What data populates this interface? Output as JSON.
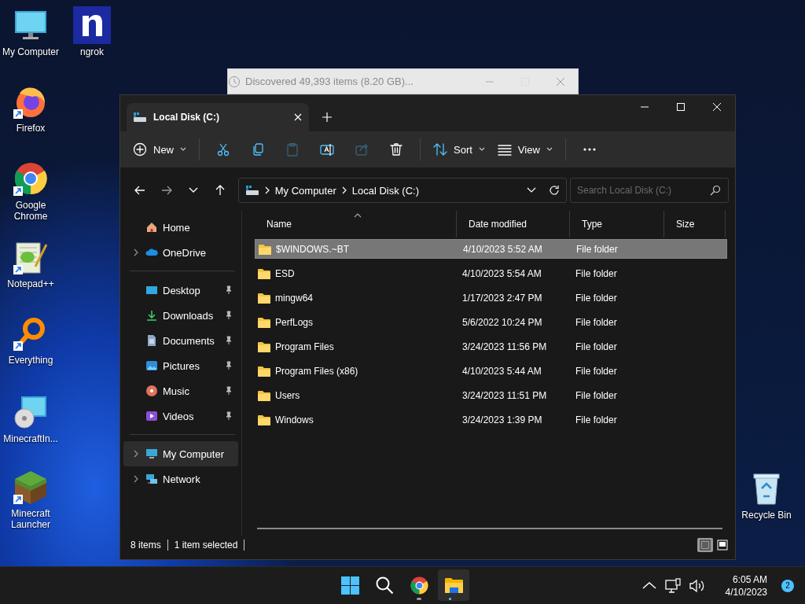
{
  "desktop_icons": [
    {
      "label": "My Computer",
      "kind": "computer",
      "shortcut": false
    },
    {
      "label": "ngrok",
      "kind": "ngrok",
      "shortcut": false
    },
    {
      "label": "Firefox",
      "kind": "firefox",
      "shortcut": true
    },
    {
      "label": "Google Chrome",
      "kind": "chrome",
      "shortcut": true
    },
    {
      "label": "Notepad++",
      "kind": "notepad",
      "shortcut": true
    },
    {
      "label": "Everything",
      "kind": "everything",
      "shortcut": true
    },
    {
      "label": "MinecraftIn...",
      "kind": "installer",
      "shortcut": false
    },
    {
      "label": "Minecraft Launcher",
      "kind": "minecraft",
      "shortcut": true
    },
    {
      "label": "Recycle Bin",
      "kind": "recycle",
      "shortcut": false
    }
  ],
  "progress_window": {
    "title": "Discovered 49,393 items (8.20 GB)..."
  },
  "explorer": {
    "tabs": [
      {
        "label": "Local Disk (C:)",
        "selected": true
      }
    ],
    "toolbar": [
      {
        "kind": "new",
        "label": "New",
        "disabled": false
      },
      {
        "kind": "cut",
        "disabled": false
      },
      {
        "kind": "copy",
        "disabled": false
      },
      {
        "kind": "paste",
        "disabled": true
      },
      {
        "kind": "rename",
        "disabled": false
      },
      {
        "kind": "share",
        "disabled": true
      },
      {
        "kind": "delete",
        "disabled": false
      },
      {
        "kind": "sort",
        "label": "Sort",
        "disabled": false
      },
      {
        "kind": "view",
        "label": "View",
        "disabled": false
      },
      {
        "kind": "more",
        "disabled": false
      }
    ],
    "breadcrumb": [
      "My Computer",
      "Local Disk (C:)"
    ],
    "search": {
      "placeholder": "Search Local Disk (C:)"
    },
    "nav_sections": [
      [
        {
          "label": "Home",
          "kind": "home",
          "expandable": false,
          "pinned": false,
          "selected": false
        },
        {
          "label": "OneDrive",
          "kind": "cloud",
          "expandable": true,
          "pinned": false,
          "selected": false
        }
      ],
      [
        {
          "label": "Desktop",
          "kind": "desktop",
          "expandable": false,
          "pinned": true,
          "selected": false
        },
        {
          "label": "Downloads",
          "kind": "downloads",
          "expandable": false,
          "pinned": true,
          "selected": false
        },
        {
          "label": "Documents",
          "kind": "documents",
          "expandable": false,
          "pinned": true,
          "selected": false
        },
        {
          "label": "Pictures",
          "kind": "pictures",
          "expandable": false,
          "pinned": true,
          "selected": false
        },
        {
          "label": "Music",
          "kind": "music",
          "expandable": false,
          "pinned": true,
          "selected": false
        },
        {
          "label": "Videos",
          "kind": "videos",
          "expandable": false,
          "pinned": true,
          "selected": false
        }
      ],
      [
        {
          "label": "My Computer",
          "kind": "computer",
          "expandable": true,
          "pinned": false,
          "selected": true
        },
        {
          "label": "Network",
          "kind": "network",
          "expandable": true,
          "pinned": false,
          "selected": false
        }
      ]
    ],
    "columns": [
      "Name",
      "Date modified",
      "Type",
      "Size"
    ],
    "rows": [
      {
        "name": "$WINDOWS.~BT",
        "date": "4/10/2023 5:52 AM",
        "type": "File folder",
        "selected": true
      },
      {
        "name": "ESD",
        "date": "4/10/2023 5:54 AM",
        "type": "File folder",
        "selected": false
      },
      {
        "name": "mingw64",
        "date": "1/17/2023 2:47 PM",
        "type": "File folder",
        "selected": false
      },
      {
        "name": "PerfLogs",
        "date": "5/6/2022 10:24 PM",
        "type": "File folder",
        "selected": false
      },
      {
        "name": "Program Files",
        "date": "3/24/2023 11:56 PM",
        "type": "File folder",
        "selected": false
      },
      {
        "name": "Program Files (x86)",
        "date": "4/10/2023 5:44 AM",
        "type": "File folder",
        "selected": false
      },
      {
        "name": "Users",
        "date": "3/24/2023 11:51 PM",
        "type": "File folder",
        "selected": false
      },
      {
        "name": "Windows",
        "date": "3/24/2023 1:39 PM",
        "type": "File folder",
        "selected": false
      }
    ],
    "status": [
      "8 items",
      "1 item selected"
    ],
    "view_modes": [
      {
        "kind": "details",
        "selected": true
      },
      {
        "kind": "tiles",
        "selected": false
      }
    ]
  },
  "taskbar": {
    "apps": [
      {
        "kind": "start",
        "running": false,
        "active": false
      },
      {
        "kind": "search",
        "running": false,
        "active": false
      },
      {
        "kind": "chrome",
        "running": true,
        "active": false
      },
      {
        "kind": "explorer",
        "running": true,
        "active": true
      }
    ],
    "time": "6:05 AM",
    "date": "4/10/2023",
    "notifications": "2"
  }
}
